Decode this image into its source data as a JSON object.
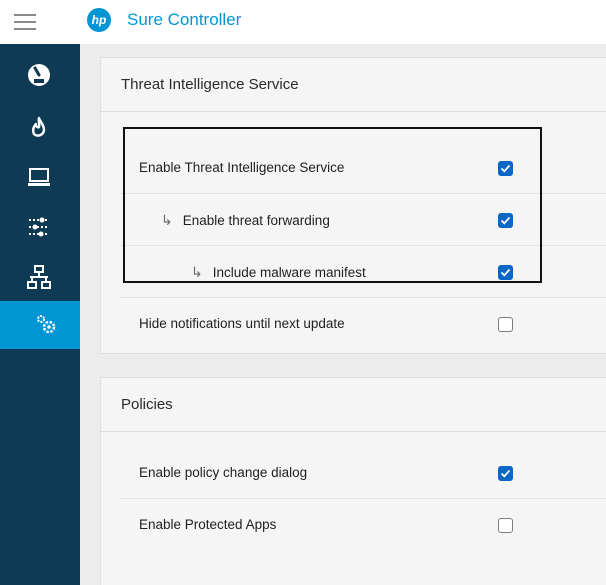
{
  "app": {
    "title": "Sure Controller",
    "logo_text": "hp"
  },
  "sidebar": {
    "items": [
      {
        "name": "dashboard",
        "icon": "gauge-icon",
        "active": false
      },
      {
        "name": "threats",
        "icon": "flame-icon",
        "active": false
      },
      {
        "name": "devices",
        "icon": "laptop-icon",
        "active": false
      },
      {
        "name": "policies",
        "icon": "sliders-icon",
        "active": false
      },
      {
        "name": "network",
        "icon": "network-icon",
        "active": false
      },
      {
        "name": "settings",
        "icon": "gears-icon",
        "active": true
      }
    ]
  },
  "threat_section": {
    "title": "Threat Intelligence Service",
    "rows": [
      {
        "label": "Enable Threat Intelligence Service",
        "checked": true
      },
      {
        "label": "Enable threat forwarding",
        "checked": true
      },
      {
        "label": "Include malware manifest",
        "checked": true
      },
      {
        "label": "Hide notifications until next update",
        "checked": false
      }
    ]
  },
  "policies_section": {
    "title": "Policies",
    "rows": [
      {
        "label": "Enable policy change dialog",
        "checked": true
      },
      {
        "label": "Enable Protected Apps",
        "checked": false
      }
    ]
  },
  "colors": {
    "brand": "#0096d6",
    "sidebar": "#0e3b53",
    "checkbox": "#0a67c7"
  }
}
